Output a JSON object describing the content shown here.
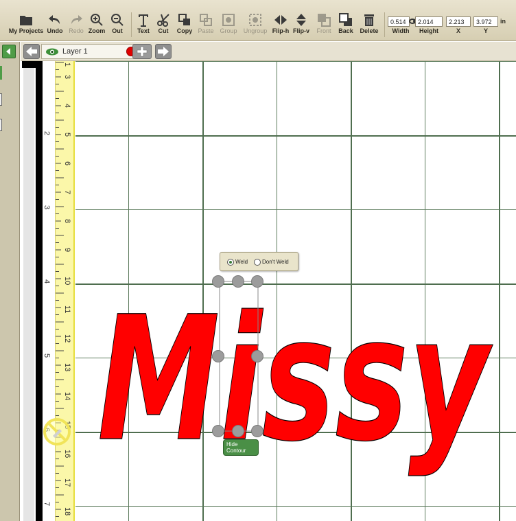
{
  "toolbar": {
    "buttons": [
      {
        "label": "My Projects",
        "enabled": true
      },
      {
        "label": "Undo",
        "enabled": true
      },
      {
        "label": "Redo",
        "enabled": false
      },
      {
        "label": "Zoom",
        "enabled": true
      },
      {
        "label": "Out",
        "enabled": true
      },
      {
        "label": "Text",
        "enabled": true
      },
      {
        "label": "Cut",
        "enabled": true
      },
      {
        "label": "Copy",
        "enabled": true
      },
      {
        "label": "Paste",
        "enabled": false
      },
      {
        "label": "Group",
        "enabled": false
      },
      {
        "label": "Ungroup",
        "enabled": false
      },
      {
        "label": "Flip-h",
        "enabled": true
      },
      {
        "label": "Flip-v",
        "enabled": true
      },
      {
        "label": "Front",
        "enabled": false
      },
      {
        "label": "Back",
        "enabled": true
      },
      {
        "label": "Delete",
        "enabled": true
      }
    ],
    "dimensions": {
      "width_value": "0.514",
      "height_value": "2.014",
      "x_value": "2.213",
      "y_value": "3.972",
      "width_label": "Width",
      "height_label": "Height",
      "x_label": "X",
      "y_label": "Y",
      "unit": "in"
    }
  },
  "layer_bar": {
    "layer_name": "Layer 1",
    "layer_color": "#e00000"
  },
  "canvas": {
    "text_content": "Missy",
    "text_color": "#ff0000",
    "ruler_vertical_labels": [
      "2",
      "3",
      "4",
      "5",
      "6",
      "7"
    ],
    "ruler_fine_labels": [
      "1",
      "3",
      "4",
      "5",
      "6",
      "7",
      "8",
      "9",
      "10",
      "11",
      "12",
      "13",
      "14",
      "15",
      "16",
      "17",
      "18"
    ]
  },
  "weld_popup": {
    "weld_label": "Weld",
    "dont_weld_label": "Don't Weld",
    "selected": "weld"
  },
  "hide_contour": {
    "line1": "Hide",
    "line2": "Contour"
  },
  "icons": {
    "my_projects": "folder-icon",
    "undo": "undo-arrow-icon",
    "redo": "redo-arrow-icon",
    "zoom": "zoom-in-icon",
    "out": "zoom-out-icon",
    "text": "text-t-icon",
    "cut": "scissors-icon",
    "copy": "copy-icon",
    "paste": "paste-icon",
    "group": "group-icon",
    "ungroup": "ungroup-icon",
    "flip_h": "flip-horizontal-icon",
    "flip_v": "flip-vertical-icon",
    "front": "bring-front-icon",
    "back": "send-back-icon",
    "delete": "trash-icon",
    "lock": "link-chain-icon",
    "eye": "eye-icon",
    "no_cut": "no-cut-icon"
  }
}
